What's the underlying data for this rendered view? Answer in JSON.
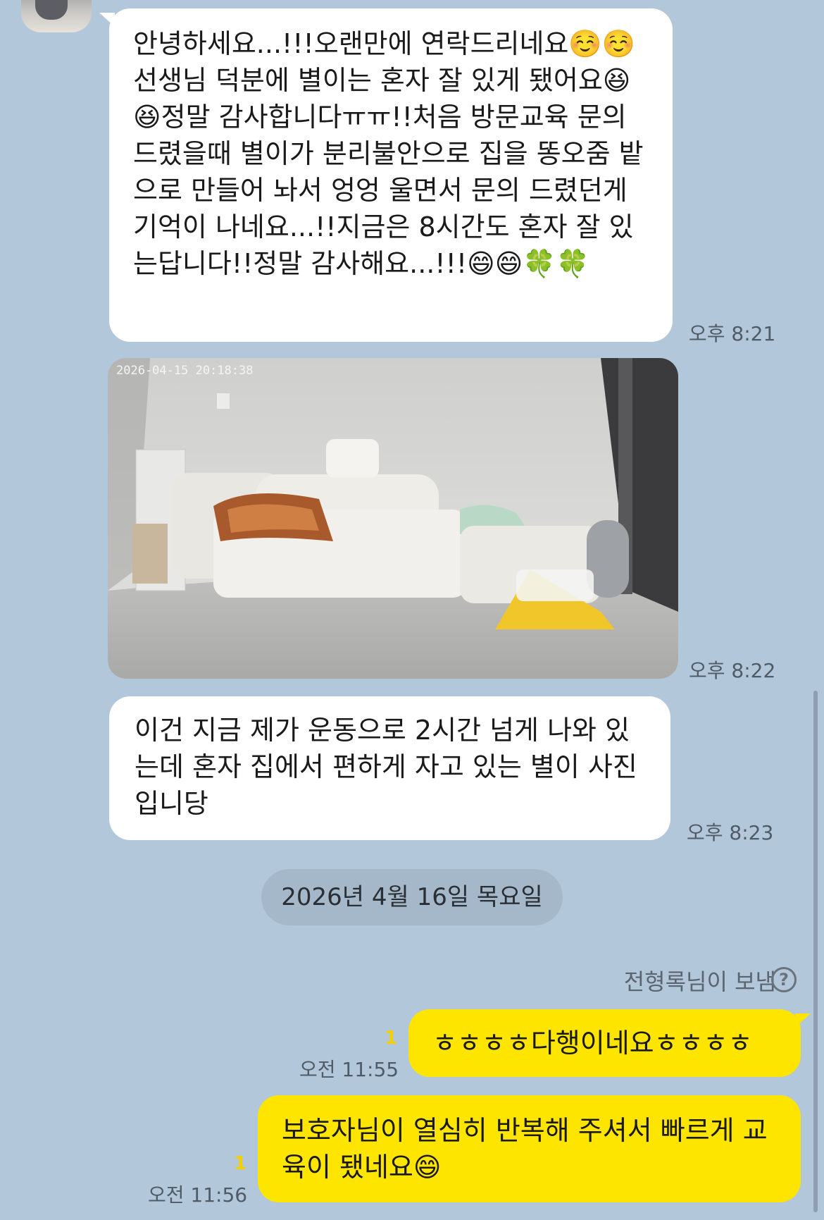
{
  "messages": {
    "m1": {
      "text": "안녕하세요...!!!오랜만에 연락드리네요☺️☺️선생님 덕분에 별이는 혼자 잘 있게 됐어요😆😆정말 감사합니다ㅠㅠ!!처음 방문교육 문의 드렸을때 별이가 분리불안으로 집을 똥오줌 밭으로 만들어 놔서 엉엉 울면서 문의 드렸던게 기억이 나네요...!!지금은 8시간도 혼자 잘 있는답니다!!정말 감사해요...!!!😄😄🍀🍀",
      "time": "오후 8:21"
    },
    "m2": {
      "photo_timestamp": "2026-04-15 20:18:38",
      "time": "오후 8:22"
    },
    "m3": {
      "text": "이건 지금 제가 운동으로 2시간 넘게 나와 있는데 혼자 집에서 편하게 자고 있는 별이 사진입니당",
      "time": "오후 8:23"
    },
    "date_divider": "2026년 4월 16일 목요일",
    "sender_note": "전형록님이 보냄",
    "help_icon": "?",
    "m4": {
      "text": "ㅎㅎㅎㅎ다행이네요ㅎㅎㅎㅎ",
      "time": "오전 11:55",
      "unread": "1"
    },
    "m5": {
      "text": "보호자님이 열심히 반복해 주셔서 빠르게 교육이 됐네요😄",
      "time": "오전 11:56",
      "unread": "1"
    }
  },
  "colors": {
    "background": "#b2c7d9",
    "received_bubble": "#ffffff",
    "sent_bubble": "#fee500",
    "unread_count": "#f3d000"
  }
}
